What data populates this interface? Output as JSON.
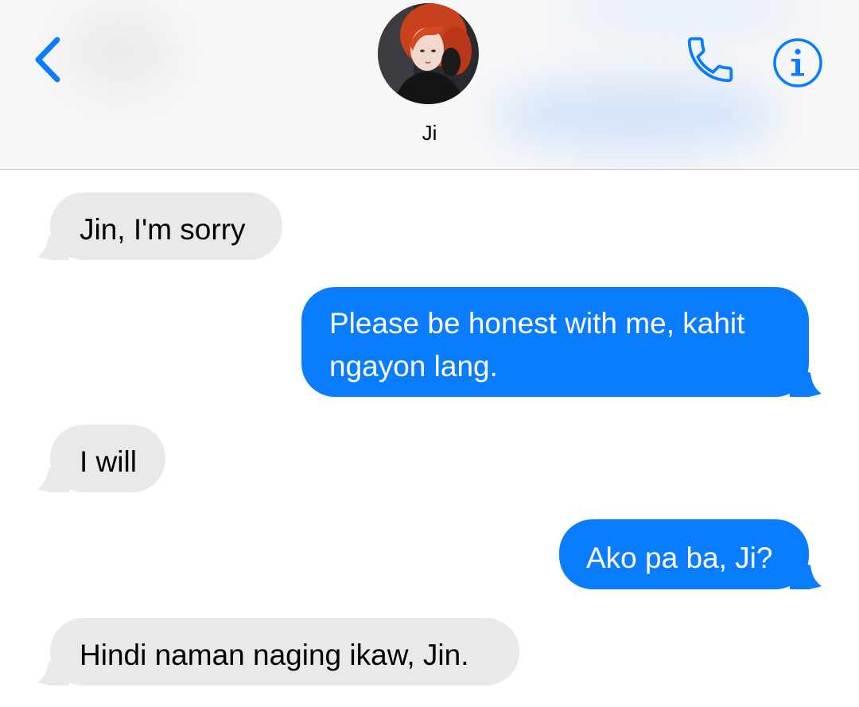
{
  "header": {
    "contact_name": "Ji",
    "back_icon": "chevron-left-icon",
    "call_icon": "phone-icon",
    "info_icon": "info-icon",
    "accent_color": "#0a7cff"
  },
  "messages": [
    {
      "direction": "incoming",
      "text": "Jin, I'm sorry"
    },
    {
      "direction": "outgoing",
      "text": "Please be honest with me, kahit ngayon lang."
    },
    {
      "direction": "incoming",
      "text": "I will"
    },
    {
      "direction": "outgoing",
      "text": "Ako pa ba, Ji?"
    },
    {
      "direction": "incoming",
      "text": "Hindi naman naging ikaw, Jin."
    }
  ],
  "colors": {
    "incoming_bubble": "#e9e9eb",
    "outgoing_bubble": "#0a7cff",
    "header_background": "#f7f7f8"
  }
}
